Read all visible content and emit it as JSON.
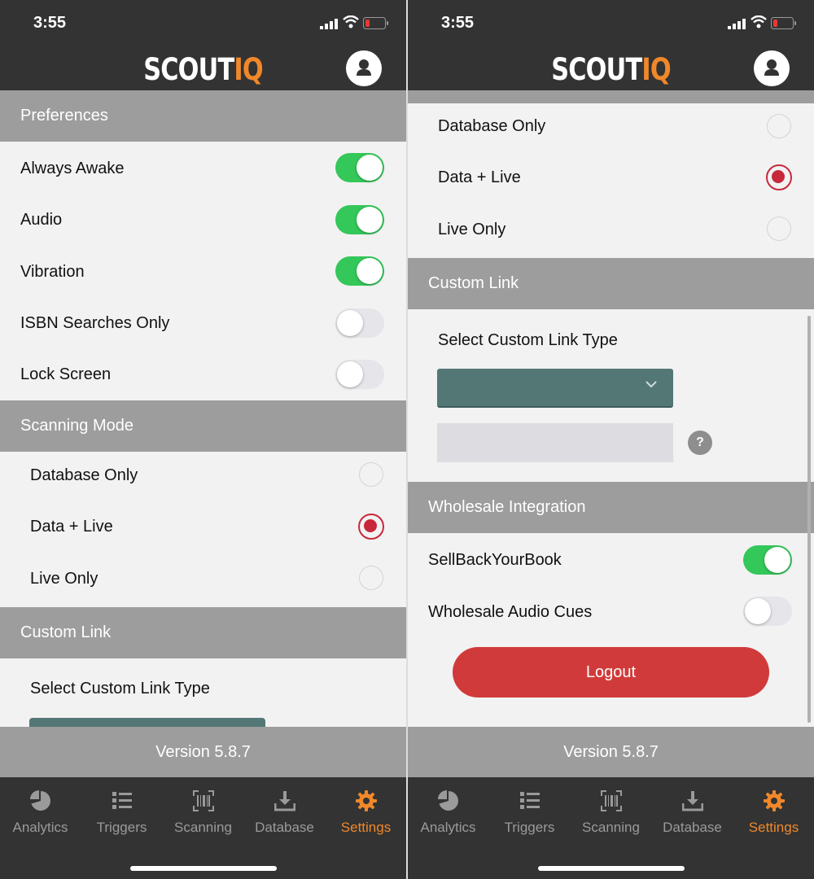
{
  "colors": {
    "accent": "#f0882a",
    "toggle_on": "#34c759",
    "radio_selected": "#c8283c",
    "logout": "#d13a3a",
    "select_box": "#537775"
  },
  "status_bar": {
    "time": "3:55"
  },
  "app": {
    "logo_part1": "SCOUT",
    "logo_part2": "IQ"
  },
  "left": {
    "preferences": {
      "header": "Preferences",
      "items": [
        {
          "label": "Always Awake",
          "on": true
        },
        {
          "label": "Audio",
          "on": true
        },
        {
          "label": "Vibration",
          "on": true
        },
        {
          "label": "ISBN Searches Only",
          "on": false
        },
        {
          "label": "Lock Screen",
          "on": false
        }
      ]
    },
    "scanning_mode": {
      "header": "Scanning Mode",
      "options": [
        {
          "label": "Database Only",
          "selected": false
        },
        {
          "label": "Data + Live",
          "selected": true
        },
        {
          "label": "Live Only",
          "selected": false
        }
      ]
    },
    "custom_link": {
      "header": "Custom Link",
      "select_label": "Select Custom Link Type"
    }
  },
  "right": {
    "scanning_mode": {
      "options": [
        {
          "label": "Database Only",
          "selected": false
        },
        {
          "label": "Data + Live",
          "selected": true
        },
        {
          "label": "Live Only",
          "selected": false
        }
      ]
    },
    "custom_link": {
      "header": "Custom Link",
      "select_label": "Select Custom Link Type",
      "select_value": "",
      "text_value": "",
      "help_icon": "?"
    },
    "wholesale": {
      "header": "Wholesale Integration",
      "items": [
        {
          "label": "SellBackYourBook",
          "on": true
        },
        {
          "label": "Wholesale Audio Cues",
          "on": false
        }
      ]
    },
    "logout_label": "Logout"
  },
  "footer": {
    "version": "Version 5.8.7"
  },
  "tabs": [
    {
      "label": "Analytics",
      "icon": "pie-chart-icon"
    },
    {
      "label": "Triggers",
      "icon": "list-icon"
    },
    {
      "label": "Scanning",
      "icon": "barcode-icon"
    },
    {
      "label": "Database",
      "icon": "download-icon"
    },
    {
      "label": "Settings",
      "icon": "gear-icon",
      "active": true
    }
  ]
}
